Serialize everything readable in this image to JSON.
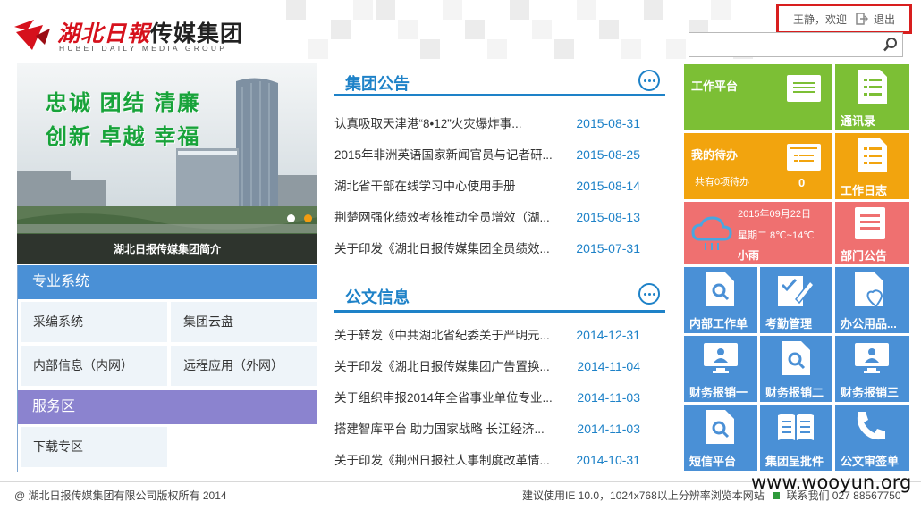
{
  "brand": {
    "name_red": "湖北日報",
    "name_black": "传媒集团",
    "name_en": "HUBEI DAILY MEDIA GROUP"
  },
  "user": {
    "name": "王静",
    "greeting": "，欢迎",
    "logout": "退出"
  },
  "search": {
    "placeholder": ""
  },
  "banner": {
    "slogan_line1": "忠诚 团结 清廉",
    "slogan_line2": "创新 卓越 幸福",
    "caption": "湖北日报传媒集团简介"
  },
  "pro_systems": {
    "title": "专业系统",
    "items": [
      "采编系统",
      "集团云盘",
      "内部信息（内网）",
      "远程应用（外网）"
    ]
  },
  "service": {
    "title": "服务区",
    "items": [
      "下载专区"
    ]
  },
  "announcements": {
    "title": "集团公告",
    "rows": [
      {
        "title": "认真吸取天津港“8•12”火灾爆炸事...",
        "date": "2015-08-31"
      },
      {
        "title": "2015年非洲英语国家新闻官员与记者研...",
        "date": "2015-08-25"
      },
      {
        "title": "湖北省干部在线学习中心使用手册",
        "date": "2015-08-14"
      },
      {
        "title": "荆楚网强化绩效考核推动全员增效（湖...",
        "date": "2015-08-13"
      },
      {
        "title": "关于印发《湖北日报传媒集团全员绩效...",
        "date": "2015-07-31"
      }
    ]
  },
  "documents": {
    "title": "公文信息",
    "rows": [
      {
        "title": "关于转发《中共湖北省纪委关于严明元...",
        "date": "2014-12-31"
      },
      {
        "title": "关于印发《湖北日报传媒集团广告置换...",
        "date": "2014-11-04"
      },
      {
        "title": "关于组织申报2014年全省事业单位专业...",
        "date": "2014-11-03"
      },
      {
        "title": "搭建智库平台 助力国家战略 长江经济...",
        "date": "2014-11-03"
      },
      {
        "title": "关于印发《荆州日报社人事制度改革情...",
        "date": "2014-10-31"
      }
    ]
  },
  "tiles": {
    "work_platform": "工作平台",
    "contacts": "通讯录",
    "todo_title": "我的待办",
    "todo_text": "共有0项待办",
    "todo_count": "0",
    "work_log": "工作日志",
    "weather_date": "2015年09月22日",
    "weather_day": "星期二 8℃~14℃",
    "weather_desc": "小雨",
    "dept_notice": "部门公告",
    "internal_ticket": "内部工作单",
    "attendance": "考勤管理",
    "office_supplies": "办公用品...",
    "finance1": "财务报销一",
    "finance2": "财务报销二",
    "finance3": "财务报销三",
    "sms": "短信平台",
    "group_approval": "集团呈批件",
    "doc_sign": "公文审签单"
  },
  "colors": {
    "blue": "#4a90d6",
    "green": "#7cbf35",
    "orange": "#f2a40e",
    "red": "#ef7070",
    "purple": "#8b83cf",
    "accent": "#1e82c8"
  },
  "footer": {
    "copyright": "@ 湖北日报传媒集团有限公司版权所有 2014",
    "browser_note": "建议使用IE 10.0，1024x768以上分辨率浏览本网站",
    "contact": "联系我们",
    "phone": "027 88567750",
    "watermark": "www.wooyun.org"
  }
}
